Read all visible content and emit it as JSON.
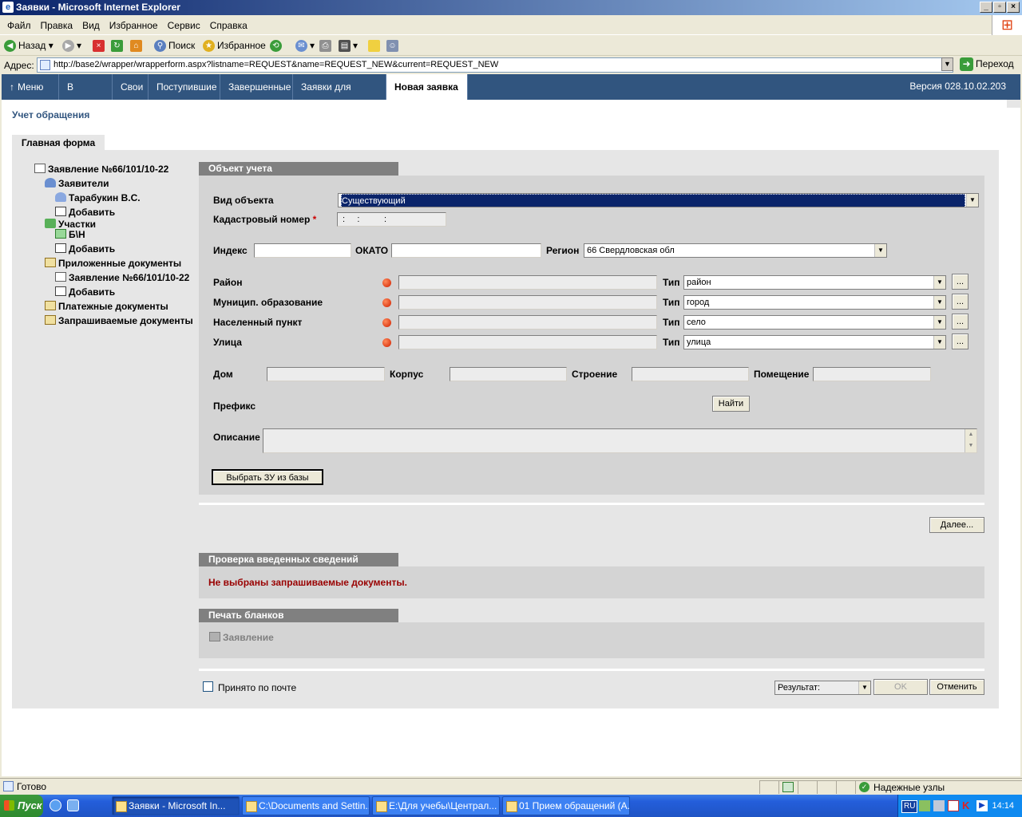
{
  "window": {
    "title": "Заявки - Microsoft Internet Explorer"
  },
  "menu": [
    "Файл",
    "Правка",
    "Вид",
    "Избранное",
    "Сервис",
    "Справка"
  ],
  "toolbar": {
    "back": "Назад",
    "search": "Поиск",
    "favorites": "Избранное"
  },
  "address": {
    "label": "Адрес:",
    "url": "http://base2/wrapper/wrapperform.aspx?listname=REQUEST&name=REQUEST_NEW&current=REQUEST_NEW",
    "go": "Переход"
  },
  "nav": {
    "tabs": [
      "Меню",
      "В работе",
      "Свои",
      "Поступившие",
      "Завершенные",
      "Заявки для приема",
      "Новая заявка"
    ],
    "active": "Новая заявка",
    "version": "Версия 028.10.02.203"
  },
  "page": {
    "title": "Учет обращения",
    "main_tab": "Главная форма"
  },
  "tree": {
    "root": "Заявление №66/101/10-22",
    "applicants": "Заявители",
    "applicant": "Тарабукин В.С.",
    "add1": "Добавить",
    "plots": "Участки",
    "plot": "Б\\Н",
    "add2": "Добавить",
    "attached": "Приложенные документы",
    "attached_doc": "Заявление №66/101/10-22",
    "add3": "Добавить",
    "payment": "Платежные документы",
    "requested": "Запрашиваемые документы"
  },
  "object": {
    "header": "Объект учета",
    "type_label": "Вид объекта",
    "type_value": "Существующий",
    "cadastral_label": "Кадастровый номер",
    "required": "*",
    "cadastral_mask": ":     :          :",
    "index_label": "Индекс",
    "okato_label": "ОКАТО",
    "region_label": "Регион",
    "region_value": "66 Свердловская обл",
    "district_label": "Район",
    "municipality_label": "Муницип. образование",
    "settlement_label": "Населенный пункт",
    "street_label": "Улица",
    "type_word": "Тип",
    "district_type": "район",
    "municipality_type": "город",
    "settlement_type": "село",
    "street_type": "улица",
    "ellipsis": "...",
    "house_label": "Дом",
    "building_label": "Корпус",
    "structure_label": "Строение",
    "room_label": "Помещение",
    "prefix_label": "Префикс",
    "find_button": "Найти",
    "description_label": "Описание",
    "choose_button": "Выбрать ЗУ из базы"
  },
  "next_button": "Далее...",
  "check": {
    "header": "Проверка введенных сведений",
    "message": "Не выбраны запрашиваемые документы."
  },
  "print": {
    "header": "Печать бланков",
    "item": "Заявление"
  },
  "footer": {
    "mail_label": "Принято по почте",
    "result": "Результат:",
    "ok": "OK",
    "cancel": "Отменить"
  },
  "status": {
    "text": "Готово",
    "zone": "Надежные узлы"
  },
  "taskbar": {
    "start": "Пуск",
    "tasks": [
      "Заявки - Microsoft In...",
      "C:\\Documents and Settin...",
      "E:\\Для учебы\\Централ...",
      "01 Прием обращений (А..."
    ],
    "lang": "RU",
    "time": "14:14"
  },
  "colors": {
    "navbar": "#31557f",
    "section_header": "#808080",
    "error": "#990000",
    "required": "#cc0000"
  }
}
